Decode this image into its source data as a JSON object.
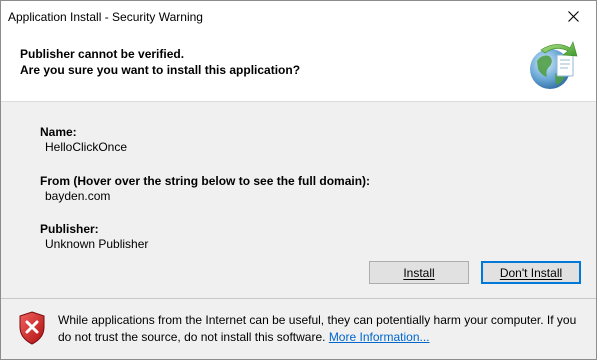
{
  "window": {
    "title": "Application Install - Security Warning"
  },
  "header": {
    "line1": "Publisher cannot be verified.",
    "line2": "Are you sure you want to install this application?"
  },
  "details": {
    "name_label": "Name:",
    "name_value": "HelloClickOnce",
    "from_label": "From (Hover over the string below to see the full domain):",
    "from_value": "bayden.com",
    "publisher_label": "Publisher:",
    "publisher_value": "Unknown Publisher"
  },
  "buttons": {
    "install_label": "Install",
    "dont_install_label": "Don't Install"
  },
  "footer": {
    "warning_text": "While applications from the Internet can be useful, they can potentially harm your computer. If you do not trust the source, do not install this software. ",
    "link_text": "More Information..."
  },
  "icons": {
    "close": "close-icon",
    "globe": "globe-install-icon",
    "shield": "security-shield-icon"
  },
  "colors": {
    "link": "#0066cc",
    "default_button_border": "#0078d7",
    "shield_red": "#d42020"
  }
}
